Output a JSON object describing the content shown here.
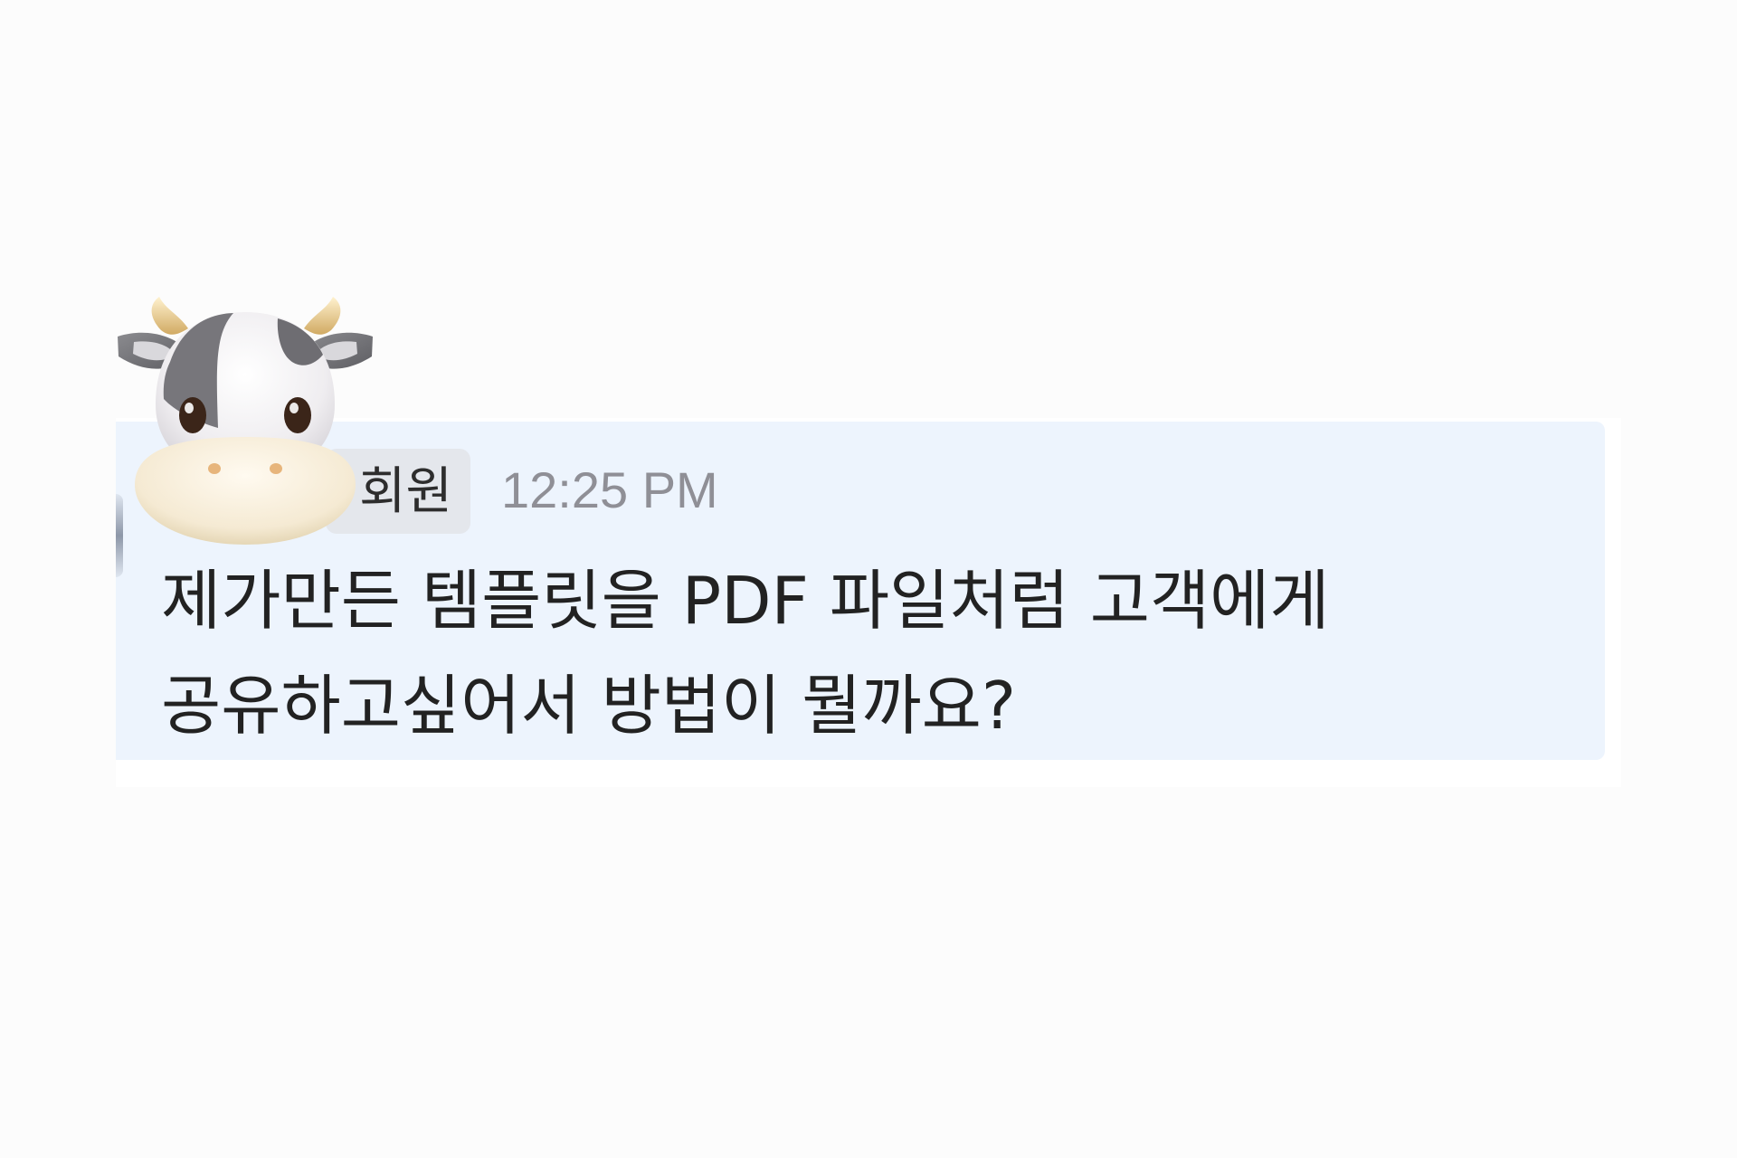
{
  "message": {
    "author": "회원",
    "time": "12:25 PM",
    "lines": [
      "제가만든 템플릿을 PDF 파일처럼 고객에게",
      "공유하고싶어서 방법이 뭘까요?"
    ]
  },
  "icons": {
    "avatar": "cow-face-icon"
  },
  "colors": {
    "bubble": "#edf4fd",
    "author_chip": "#e4e7ec",
    "text": "#222222",
    "timestamp": "#8f8f96"
  }
}
